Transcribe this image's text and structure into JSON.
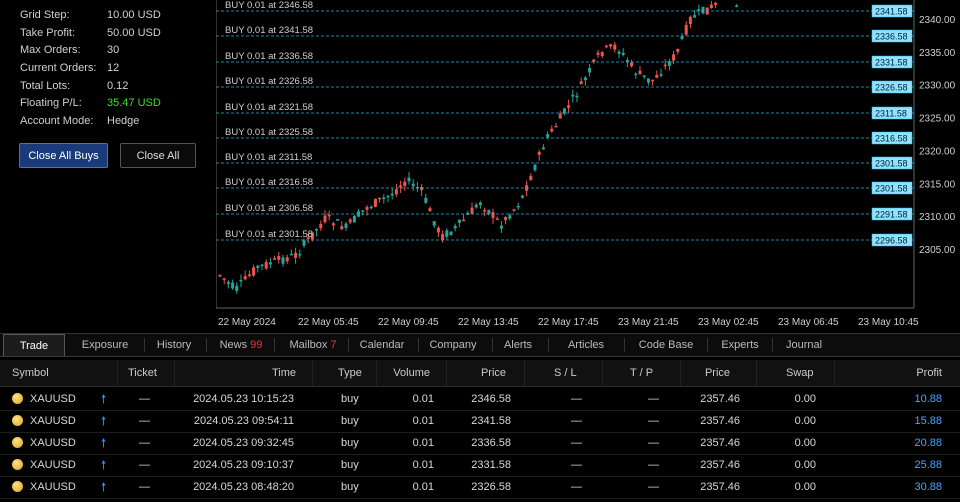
{
  "info": {
    "rows": [
      {
        "label": "Grid Step:",
        "value": "10.00 USD"
      },
      {
        "label": "Take Profit:",
        "value": "50.00 USD"
      },
      {
        "label": "Max Orders:",
        "value": "30"
      },
      {
        "label": "Current Orders:",
        "value": "12"
      },
      {
        "label": "Total Lots:",
        "value": "0.12"
      },
      {
        "label": "Floating P/L:",
        "value": "35.47 USD"
      },
      {
        "label": "Account Mode:",
        "value": "Hedge"
      }
    ],
    "positive_color": "#3ddc2f",
    "close_buys_label": "Close All Buys",
    "close_all_label": "Close All"
  },
  "chart": {
    "grid_levels": [
      {
        "label": "BUY 0.01 at 2346.58",
        "tag": "2341.58"
      },
      {
        "label": "BUY 0.01 at 2341.58",
        "tag": "2336.58"
      },
      {
        "label": "BUY 0.01 at 2336.58",
        "tag": "2331.58"
      },
      {
        "label": "BUY 0.01 at 2326.58",
        "tag": "2326.58"
      },
      {
        "label": "BUY 0.01 at 2321.58",
        "tag": "2311.58"
      },
      {
        "label": "BUY 0.01 at 2325.58",
        "tag": "2316.58"
      },
      {
        "label": "BUY 0.01 at 2311.58",
        "tag": "2301.58"
      },
      {
        "label": "BUY 0.01 at 2316.58",
        "tag": "2301.58"
      },
      {
        "label": "BUY 0.01 at 2306.58",
        "tag": "2291.58"
      },
      {
        "label": "BUY 0.01 at 2301.58",
        "tag": "2296.58"
      }
    ],
    "price_ticks": [
      "2340.00",
      "2335.00",
      "2330.00",
      "2325.00",
      "2320.00",
      "2315.00",
      "2310.00",
      "2305.00"
    ],
    "time_ticks": [
      "22 May 2024",
      "22 May 05:45",
      "22 May 09:45",
      "22 May 13:45",
      "22 May 17:45",
      "23 May 21:45",
      "23 May 02:45",
      "23 May 06:45",
      "23 May 10:45"
    ],
    "level_color": "#29b6e8",
    "bull_color": "#26a69a",
    "bear_color": "#ef5350"
  },
  "tabs": [
    {
      "label": "Trade",
      "active": true
    },
    {
      "label": "Exposure"
    },
    {
      "label": "History"
    },
    {
      "label": "News",
      "count": "99"
    },
    {
      "label": "Mailbox",
      "count": "7"
    },
    {
      "label": "Calendar"
    },
    {
      "label": "Company"
    },
    {
      "label": "Alerts"
    },
    {
      "label": "Articles"
    },
    {
      "label": "Code Base"
    },
    {
      "label": "Experts"
    },
    {
      "label": "Journal"
    }
  ],
  "table": {
    "headers": {
      "symbol": "Symbol",
      "ticket": "Ticket",
      "time": "Time",
      "type": "Type",
      "volume": "Volume",
      "price": "Price",
      "sl": "S / L",
      "tp": "T / P",
      "cur_price": "Price",
      "swap": "Swap",
      "profit": "Profit"
    },
    "rows": [
      {
        "symbol": "XAUUSD",
        "ticket": "—",
        "time": "2024.05.23 10:15:23",
        "type": "buy",
        "volume": "0.01",
        "price": "2346.58",
        "sl": "—",
        "tp": "—",
        "cur_price": "2357.46",
        "swap": "0.00",
        "profit": "10.88"
      },
      {
        "symbol": "XAUUSD",
        "ticket": "—",
        "time": "2024.05.23 09:54:11",
        "type": "buy",
        "volume": "0.01",
        "price": "2341.58",
        "sl": "—",
        "tp": "—",
        "cur_price": "2357.46",
        "swap": "0.00",
        "profit": "15.88"
      },
      {
        "symbol": "XAUUSD",
        "ticket": "—",
        "time": "2024.05.23 09:32:45",
        "type": "buy",
        "volume": "0.01",
        "price": "2336.58",
        "sl": "—",
        "tp": "—",
        "cur_price": "2357.46",
        "swap": "0.00",
        "profit": "20.88"
      },
      {
        "symbol": "XAUUSD",
        "ticket": "—",
        "time": "2024.05.23 09:10:37",
        "type": "buy",
        "volume": "0.01",
        "price": "2331.58",
        "sl": "—",
        "tp": "—",
        "cur_price": "2357.46",
        "swap": "0.00",
        "profit": "25.88"
      },
      {
        "symbol": "XAUUSD",
        "ticket": "—",
        "time": "2024.05.23 08:48:20",
        "type": "buy",
        "volume": "0.01",
        "price": "2326.58",
        "sl": "—",
        "tp": "—",
        "cur_price": "2357.46",
        "swap": "0.00",
        "profit": "30.88"
      }
    ]
  }
}
